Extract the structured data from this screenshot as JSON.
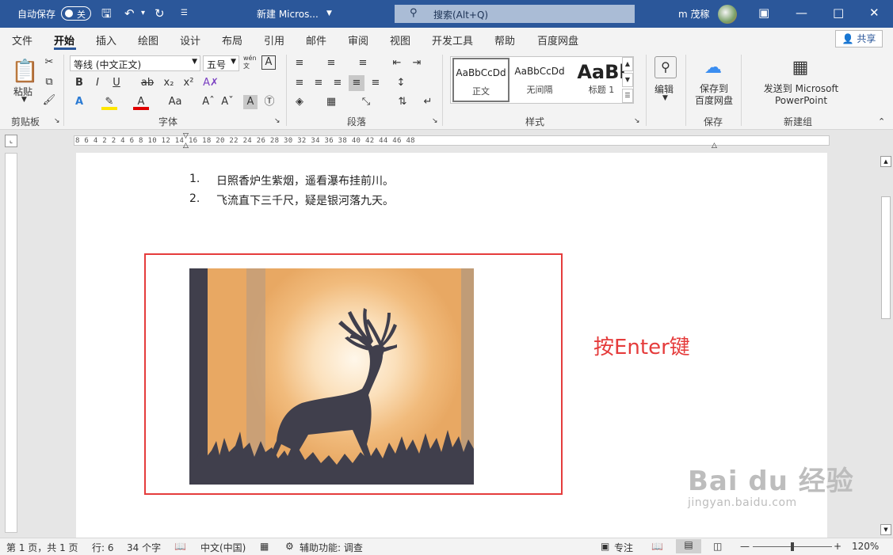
{
  "titlebar": {
    "autosave_label": "自动保存",
    "autosave_state": "关",
    "doc_title": "新建 Micros...",
    "search_placeholder": "搜索(Alt+Q)",
    "user_name": "m 茂稼"
  },
  "tabs": [
    "文件",
    "开始",
    "插入",
    "绘图",
    "设计",
    "布局",
    "引用",
    "邮件",
    "审阅",
    "视图",
    "开发工具",
    "帮助",
    "百度网盘"
  ],
  "active_tab": "开始",
  "share_label": "共享",
  "ribbon": {
    "paste_label": "粘贴",
    "font_name": "等线 (中文正文)",
    "font_size": "五号",
    "wen_label": "wén 文",
    "styles": [
      {
        "preview": "AaBbCcDd",
        "name": "正文",
        "selected": true
      },
      {
        "preview": "AaBbCcDd",
        "name": "无间隔",
        "selected": false
      },
      {
        "preview": "AaBl",
        "name": "标题 1",
        "selected": false
      }
    ],
    "edit_label": "编辑",
    "save_baidu_label": "保存到 百度网盘",
    "send_ppt_label": "发送到 Microsoft PowerPoint",
    "groups": {
      "clipboard": "剪贴板",
      "font": "字体",
      "paragraph": "段落",
      "styles": "样式",
      "save": "保存",
      "new_group": "新建组"
    }
  },
  "ruler": {
    "marks": "8 6 4 2 2 4 6 8 10 12 14 16 18 20 22 24 26 28 30 32 34 36 38 40 42 44 46 48"
  },
  "document": {
    "list_items": [
      {
        "num": "1.",
        "text": "日照香炉生紫烟，遥看瀑布挂前川。"
      },
      {
        "num": "2.",
        "text": "飞流直下三千尺，疑是银河落九天。"
      }
    ],
    "annotation": "按Enter键"
  },
  "statusbar": {
    "page": "第 1 页，共 1 页",
    "line": "行: 6",
    "word_count": "34 个字",
    "language": "中文(中国)",
    "accessibility": "辅助功能: 调查",
    "focus": "专注",
    "zoom": "120%"
  },
  "watermark": {
    "brand": "Bai du 经验",
    "url": "jingyan.baidu.com"
  },
  "colors": {
    "titlebar": "#2b579a",
    "annotation_red": "#e53c3c"
  }
}
